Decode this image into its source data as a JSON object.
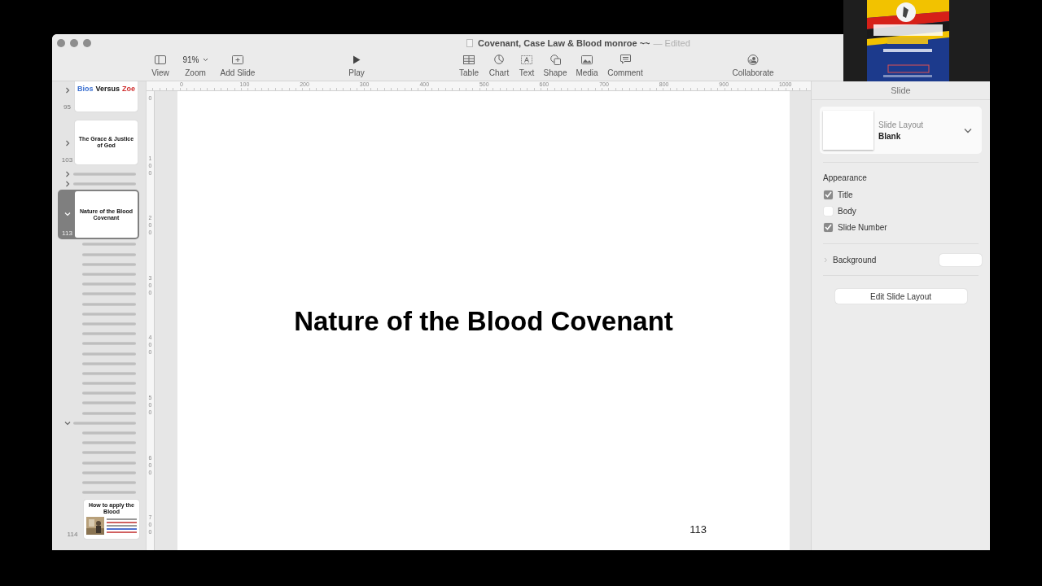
{
  "window": {
    "title": "Covenant, Case Law & Blood monroe ~~",
    "status": "— Edited"
  },
  "toolbar": [
    {
      "kind": "view",
      "label": "View"
    },
    {
      "kind": "zoom",
      "label": "Zoom",
      "value": "91%"
    },
    {
      "kind": "add",
      "label": "Add Slide"
    },
    {
      "kind": "play",
      "label": "Play"
    },
    {
      "kind": "table",
      "label": "Table"
    },
    {
      "kind": "chart",
      "label": "Chart"
    },
    {
      "kind": "text",
      "label": "Text"
    },
    {
      "kind": "shape",
      "label": "Shape"
    },
    {
      "kind": "media",
      "label": "Media"
    },
    {
      "kind": "comment",
      "label": "Comment"
    },
    {
      "kind": "collaborate",
      "label": "Collaborate"
    }
  ],
  "navigator": [
    {
      "kind": "thumb",
      "number": "95",
      "selected": false,
      "expanded": false,
      "title_parts": [
        {
          "text": "Bios",
          "color": "#3a6fd0"
        },
        {
          "text": "Versus",
          "color": "#111111"
        },
        {
          "text": "Zoe",
          "color": "#d03030"
        }
      ]
    },
    {
      "kind": "thumb",
      "number": "103",
      "selected": false,
      "expanded": false,
      "title_parts": [
        {
          "text": "The Grace & Justice of God"
        }
      ]
    },
    {
      "kind": "skipped",
      "selected": false,
      "expanded": false
    },
    {
      "kind": "skipped",
      "selected": false,
      "expanded": false
    },
    {
      "kind": "thumb",
      "number": "113",
      "selected": true,
      "expanded": true,
      "title_parts": [
        {
          "text": "Nature of the Blood Covenant"
        }
      ],
      "children": [
        {
          "kind": "skipped",
          "selected": false
        },
        {
          "kind": "skipped",
          "selected": false
        },
        {
          "kind": "skipped",
          "selected": false
        },
        {
          "kind": "skipped",
          "selected": false
        },
        {
          "kind": "skipped",
          "selected": false
        },
        {
          "kind": "skipped",
          "selected": false
        },
        {
          "kind": "skipped",
          "selected": false
        },
        {
          "kind": "skipped",
          "selected": false
        },
        {
          "kind": "skipped",
          "selected": false
        },
        {
          "kind": "skipped",
          "selected": false
        },
        {
          "kind": "skipped",
          "selected": false
        },
        {
          "kind": "skipped",
          "selected": false
        },
        {
          "kind": "skipped",
          "selected": false
        },
        {
          "kind": "skipped",
          "selected": false
        },
        {
          "kind": "skipped",
          "selected": false
        },
        {
          "kind": "skipped",
          "selected": false
        },
        {
          "kind": "skipped",
          "selected": false
        },
        {
          "kind": "skipped",
          "selected": false
        }
      ]
    },
    {
      "kind": "skipped",
      "selected": false,
      "expanded": true,
      "children": [
        {
          "kind": "skipped",
          "selected": false
        },
        {
          "kind": "skipped",
          "selected": false
        },
        {
          "kind": "skipped",
          "selected": false
        },
        {
          "kind": "skipped",
          "selected": false
        },
        {
          "kind": "skipped",
          "selected": false
        },
        {
          "kind": "skipped",
          "selected": false
        },
        {
          "kind": "skipped",
          "selected": false
        },
        {
          "kind": "thumb",
          "number": "114",
          "selected": false,
          "title_parts": [
            {
              "text": "How to apply the Blood"
            }
          ]
        }
      ]
    }
  ],
  "ruler": {
    "horizontal": [
      "0",
      "100",
      "200",
      "300",
      "400",
      "500",
      "600",
      "700",
      "800",
      "900",
      "1000"
    ],
    "vertical": [
      "0",
      "100",
      "200",
      "300",
      "400",
      "500",
      "600",
      "700"
    ]
  },
  "slide": {
    "title": "Nature of the Blood Covenant",
    "number": "113"
  },
  "inspector": {
    "tab": "Slide",
    "layout_label": "Slide Layout",
    "layout_value": "Blank",
    "section": "Appearance",
    "options": [
      {
        "label": "Title",
        "checked": true
      },
      {
        "label": "Body",
        "checked": false
      },
      {
        "label": "Slide Number",
        "checked": true
      }
    ],
    "background_label": "Background",
    "button": "Edit Slide Layout"
  }
}
